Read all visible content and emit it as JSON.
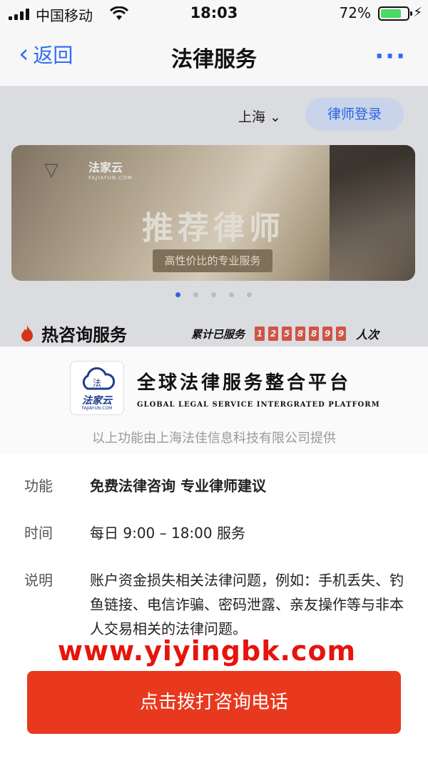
{
  "status_bar": {
    "carrier": "中国移动",
    "time": "18:03",
    "battery": "72%"
  },
  "nav": {
    "back_label": "返回",
    "title": "法律服务"
  },
  "background_page": {
    "city": "上海",
    "lawyer_login": "律师登录",
    "banner": {
      "brand": "法家云",
      "brand_domain": "FAJIAYUN.COM",
      "headline": "推荐律师",
      "subtitle": "高性价比的专业服务"
    },
    "hot_title": "热咨询服务",
    "served_label": "累计已服务",
    "served_digits": [
      "1",
      "2",
      "5",
      "8",
      "8",
      "9",
      "9"
    ],
    "served_unit": "人次"
  },
  "provider": {
    "logo_char": "法",
    "logo_text": "法家云",
    "logo_domain": "FAJIAYUN.COM",
    "platform_cn": "全球法律服务整合平台",
    "platform_en": "GLOBAL LEGAL SERVICE INTERGRATED PLATFORM",
    "provided_by": "以上功能由上海法佳信息科技有限公司提供"
  },
  "details": [
    {
      "key": "功能",
      "value": "免费法律咨询 专业律师建议"
    },
    {
      "key": "时间",
      "value": "每日 9:00 – 18:00 服务"
    },
    {
      "key": "说明",
      "value": "账户资金损失相关法律问题，例如：手机丢失、钓鱼链接、电信诈骗、密码泄露、亲友操作等与非本人交易相关的法律问题。"
    }
  ],
  "watermark": "www.yiyingbk.com",
  "call_button": "点击拨打咨询电话",
  "colors": {
    "accent": "#2f6cf6",
    "call_button": "#e8391e",
    "watermark": "#e6140c"
  }
}
